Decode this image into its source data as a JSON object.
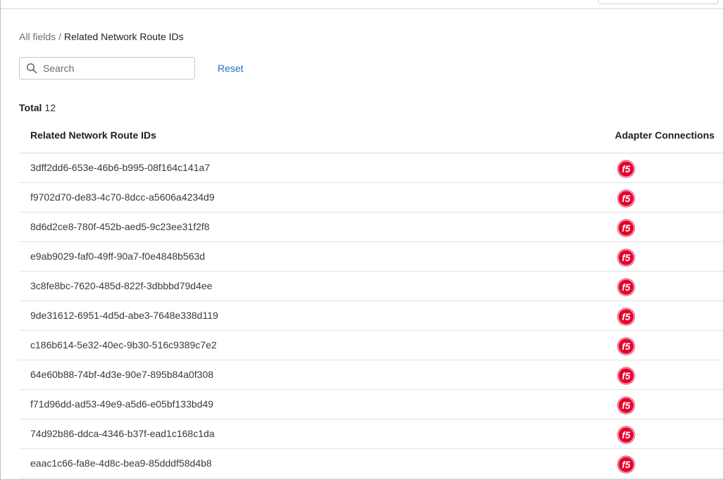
{
  "breadcrumb": {
    "parent": "All fields",
    "separator": "/",
    "current": "Related Network Route IDs"
  },
  "search": {
    "placeholder": "Search",
    "value": ""
  },
  "reset_label": "Reset",
  "total": {
    "label": "Total",
    "count": "12"
  },
  "table": {
    "columns": [
      "Related Network Route IDs",
      "Adapter Connections"
    ],
    "rows": [
      {
        "id": "3dff2dd6-653e-46b6-b995-08f164c141a7",
        "adapter_icon": "f5-logo-icon"
      },
      {
        "id": "f9702d70-de83-4c70-8dcc-a5606a4234d9",
        "adapter_icon": "f5-logo-icon"
      },
      {
        "id": "8d6d2ce8-780f-452b-aed5-9c23ee31f2f8",
        "adapter_icon": "f5-logo-icon"
      },
      {
        "id": "e9ab9029-faf0-49ff-90a7-f0e4848b563d",
        "adapter_icon": "f5-logo-icon"
      },
      {
        "id": "3c8fe8bc-7620-485d-822f-3dbbbd79d4ee",
        "adapter_icon": "f5-logo-icon"
      },
      {
        "id": "9de31612-6951-4d5d-abe3-7648e338d119",
        "adapter_icon": "f5-logo-icon"
      },
      {
        "id": "c186b614-5e32-40ec-9b30-516c9389c7e2",
        "adapter_icon": "f5-logo-icon"
      },
      {
        "id": "64e60b88-74bf-4d3e-90e7-895b84a0f308",
        "adapter_icon": "f5-logo-icon"
      },
      {
        "id": "f71d96dd-ad53-49e9-a5d6-e05bf133bd49",
        "adapter_icon": "f5-logo-icon"
      },
      {
        "id": "74d92b86-ddca-4346-b37f-ead1c168c1da",
        "adapter_icon": "f5-logo-icon"
      },
      {
        "id": "eaac1c66-fa8e-4d8c-bea9-85dddf58d4b8",
        "adapter_icon": "f5-logo-icon"
      }
    ]
  },
  "colors": {
    "link": "#1f6fc5",
    "f5_red": "#e4002b"
  }
}
